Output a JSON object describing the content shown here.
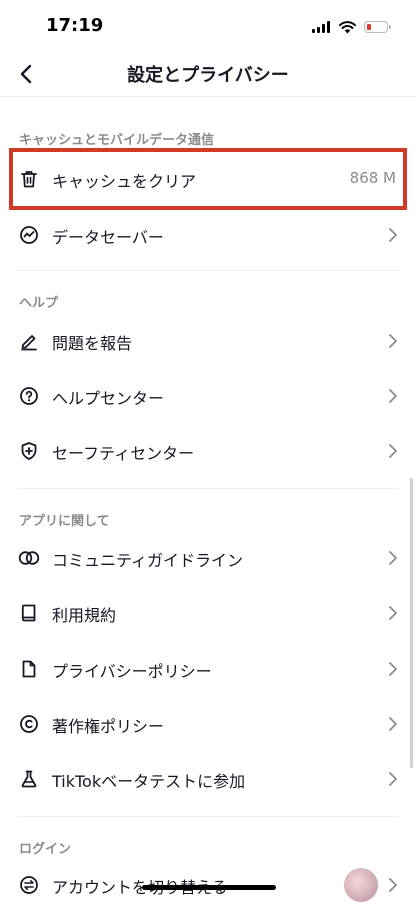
{
  "status_bar": {
    "time": "17:19"
  },
  "nav": {
    "title": "設定とプライバシー"
  },
  "sections": {
    "cache": {
      "header": "キャッシュとモバイルデータ通信",
      "clear_cache": {
        "label": "キャッシュをクリア",
        "value": "868 M"
      },
      "data_saver": {
        "label": "データセーバー"
      }
    },
    "help": {
      "header": "ヘルプ",
      "report": {
        "label": "問題を報告"
      },
      "help_center": {
        "label": "ヘルプセンター"
      },
      "safety_center": {
        "label": "セーフティセンター"
      }
    },
    "about": {
      "header": "アプリに関して",
      "community": {
        "label": "コミュニティガイドライン"
      },
      "terms": {
        "label": "利用規約"
      },
      "privacy": {
        "label": "プライバシーポリシー"
      },
      "copyright": {
        "label": "著作権ポリシー"
      },
      "beta": {
        "label": "TikTokベータテストに参加"
      }
    },
    "login": {
      "header": "ログイン",
      "switch_account": {
        "label": "アカウントを切り替える"
      }
    }
  },
  "colors": {
    "highlight": "#d13a26",
    "text": "#161823",
    "secondary": "#8a8b91"
  }
}
